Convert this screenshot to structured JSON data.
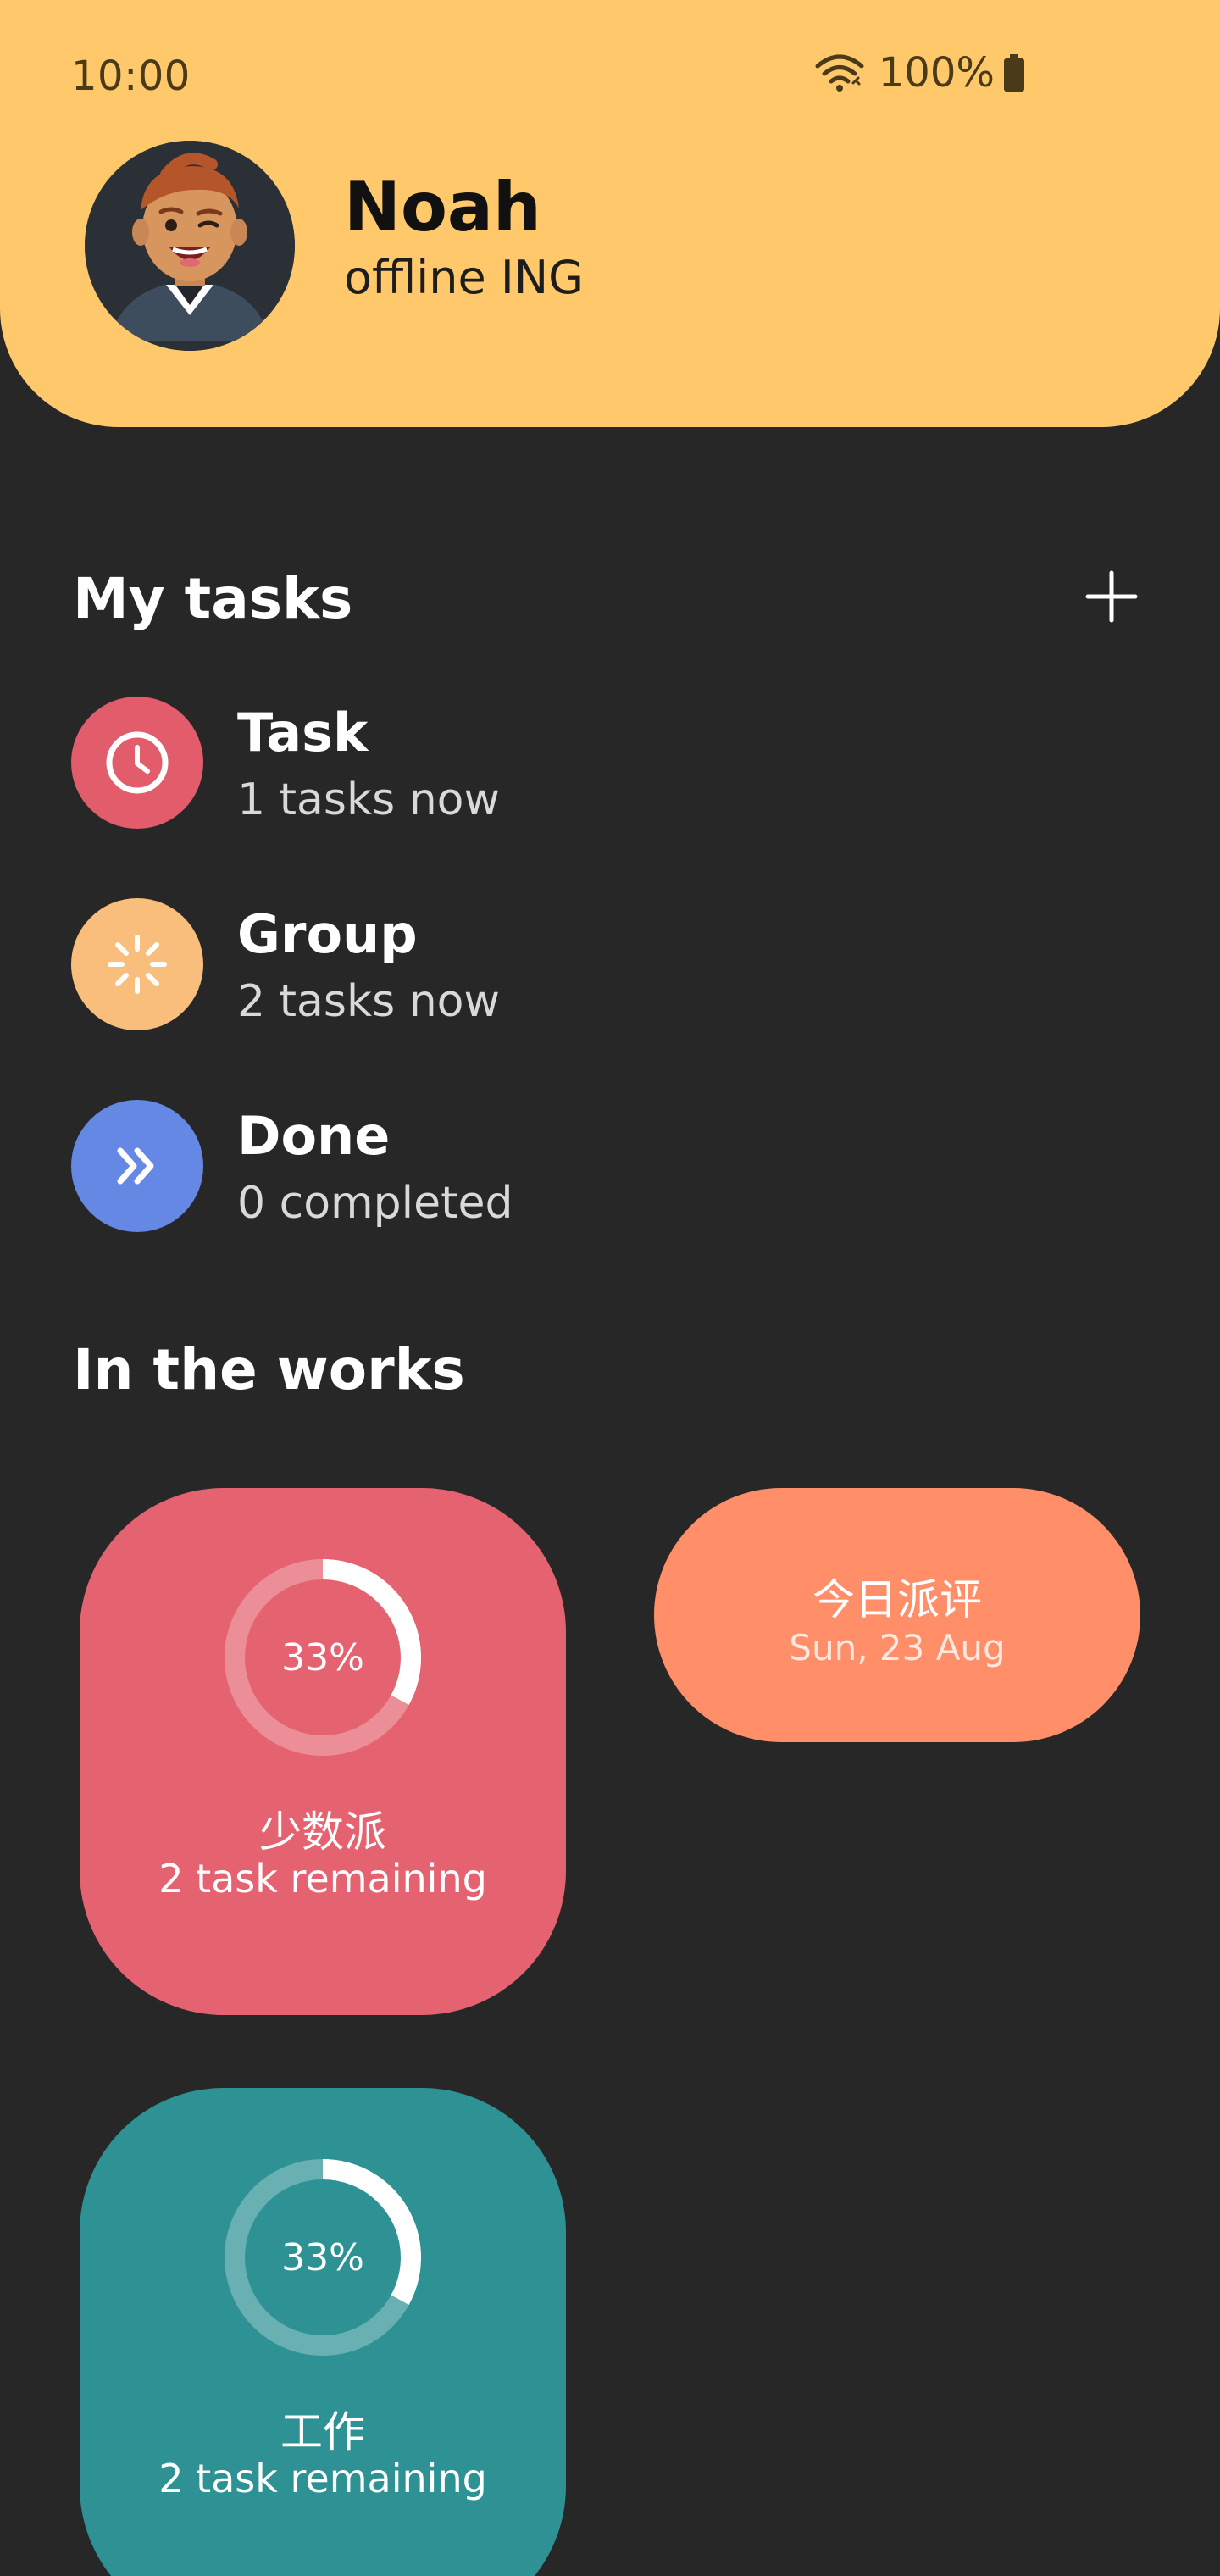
{
  "status_bar": {
    "time": "10:00",
    "battery": "100%",
    "icons": [
      "wifi-icon",
      "battery-icon"
    ]
  },
  "profile": {
    "name": "Noah",
    "status": "offline ING",
    "avatar_icon": "avatar-man-winking"
  },
  "my_tasks": {
    "title": "My tasks",
    "add_icon": "plus-icon",
    "items": [
      {
        "title": "Task",
        "subtitle": "1 tasks now",
        "icon": "clock-icon",
        "color": "#E25C6B"
      },
      {
        "title": "Group",
        "subtitle": "2 tasks now",
        "icon": "loader-icon",
        "color": "#F9BE7C"
      },
      {
        "title": "Done",
        "subtitle": "0 completed",
        "icon": "double-chevron-right-icon",
        "color": "#6488E4"
      }
    ]
  },
  "in_the_works": {
    "title": "In the works",
    "cards": [
      {
        "title": "少数派",
        "subtitle": "2 task remaining",
        "progress_label": "33%",
        "progress": 0.33,
        "color": "#E56371"
      },
      {
        "title": "今日派评",
        "date": "Sun, 23 Aug",
        "color": "#FF8E69"
      },
      {
        "title": "工作",
        "subtitle": "2 task remaining",
        "progress_label": "33%",
        "progress": 0.33,
        "color": "#2E9294"
      }
    ]
  },
  "colors": {
    "header": "#FFC86A",
    "background": "#272727"
  }
}
